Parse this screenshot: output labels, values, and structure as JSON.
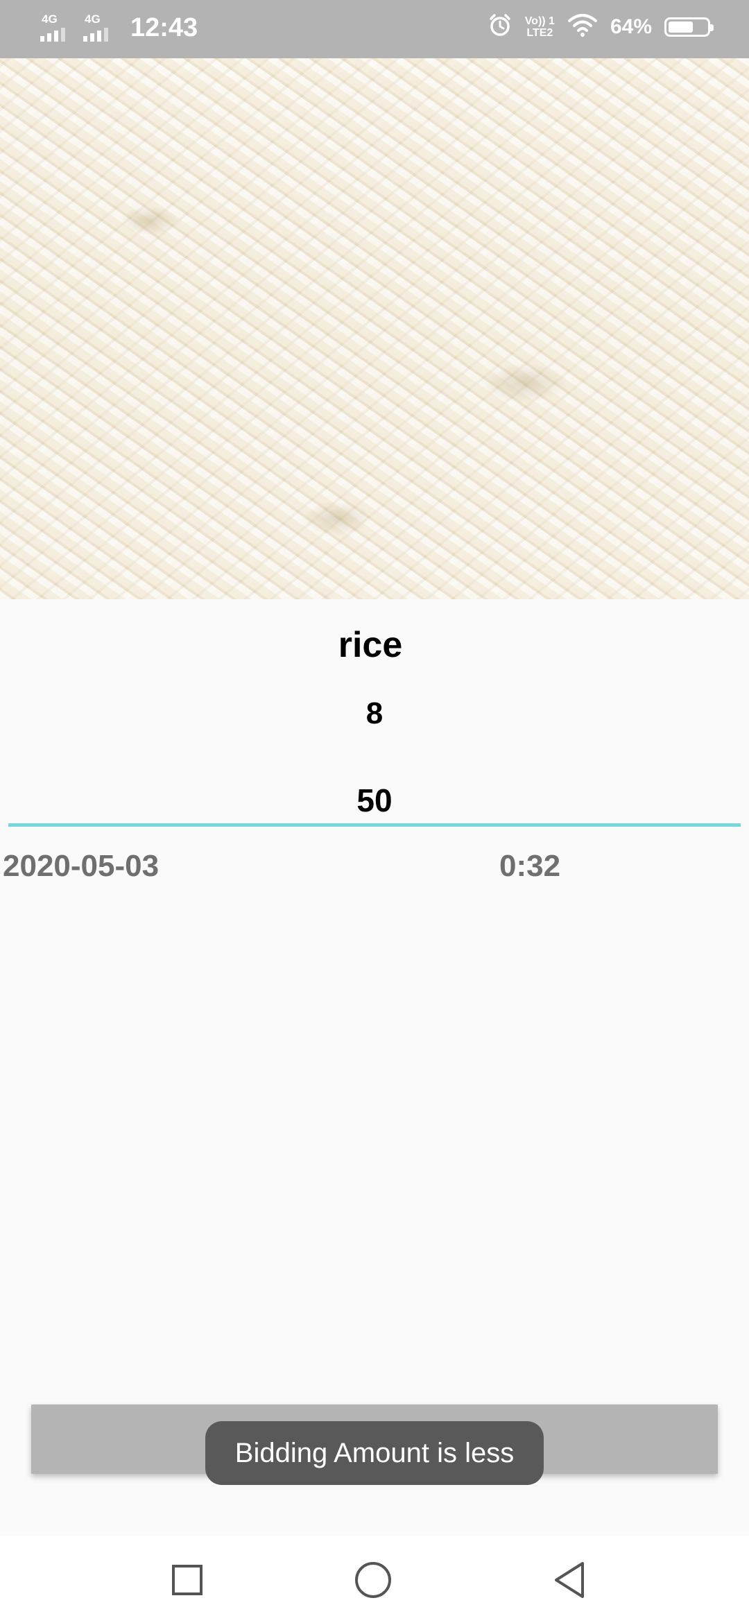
{
  "status_bar": {
    "network_1": "4G",
    "network_2": "4G",
    "time": "12:43",
    "volte_line1": "Vo)) 1",
    "volte_line2": "LTE2",
    "battery_percent": "64%",
    "battery_level": 0.64,
    "icons": [
      "signal-icon",
      "alarm-icon",
      "wifi-icon",
      "battery-icon"
    ]
  },
  "product": {
    "image": "rice-grains-photo",
    "name": "rice",
    "quantity": "8",
    "bid_amount": "50",
    "date": "2020-05-03",
    "time": "0:32"
  },
  "toast": {
    "message": "Bidding Amount is less"
  },
  "nav_bar": {
    "icons": [
      "recents-icon",
      "home-icon",
      "back-icon"
    ]
  },
  "colors": {
    "status_bar": "#b3b3b3",
    "input_underline": "#79d6dd",
    "toast_bg": "#595959",
    "overlay_bar": "#b4b4b4",
    "secondary_text": "#6f6f6f"
  }
}
